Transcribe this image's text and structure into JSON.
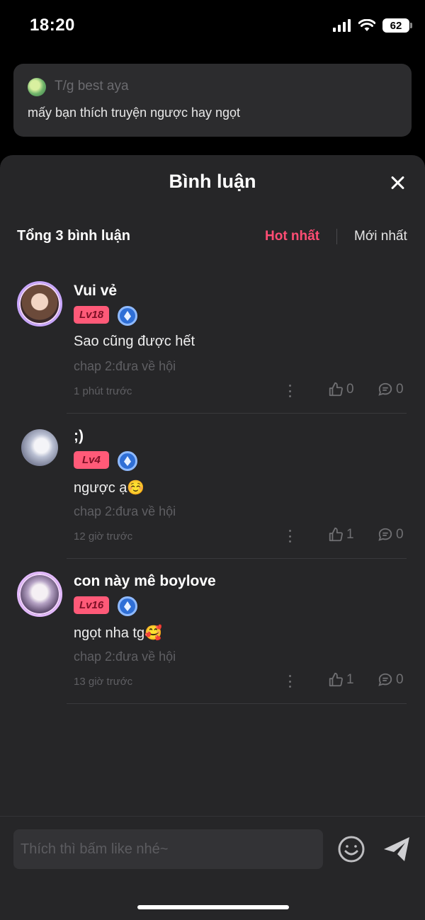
{
  "status_bar": {
    "time": "18:20",
    "battery": "62"
  },
  "post": {
    "author": "T/g best aya",
    "text": "mấy bạn thích truyện ngược hay ngọt"
  },
  "sheet": {
    "title": "Bình luận"
  },
  "comments_header": {
    "total": "Tổng 3 bình luận",
    "sort_hot": "Hot nhất",
    "sort_new": "Mới nhất"
  },
  "comments": [
    {
      "name": "Vui vẻ",
      "level": "Lv18",
      "text": "Sao cũng được hết",
      "chapter": "chap 2:đưa về hội",
      "time": "1 phút trước",
      "likes": "0",
      "replies": "0"
    },
    {
      "name": ";)",
      "level": "Lv4",
      "text": "ngược ạ☺️",
      "chapter": "chap 2:đưa về hội",
      "time": "12 giờ trước",
      "likes": "1",
      "replies": "0"
    },
    {
      "name": "con này mê boylove",
      "level": "Lv16",
      "text": "ngọt nha tg🥰",
      "chapter": "chap 2:đưa về hội",
      "time": "13 giờ trước",
      "likes": "1",
      "replies": "0"
    }
  ],
  "input": {
    "placeholder": "Thích thì bấm like nhé~"
  },
  "colors": {
    "accent": "#ff4d74",
    "badge": "#ff5a78",
    "sheet_bg": "#262628",
    "card_bg": "#2c2c2e"
  }
}
